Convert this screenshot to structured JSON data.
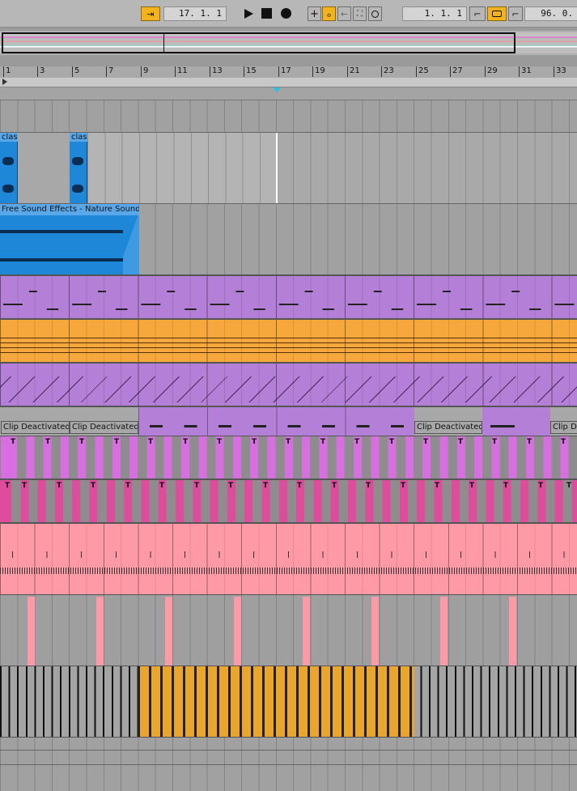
{
  "transport": {
    "follow_icon": "follow-arrow-icon",
    "position": "17.  1.  1",
    "play_icon": "play-icon",
    "stop_icon": "stop-icon",
    "record_icon": "record-icon",
    "loop_start": "1.  1.  1",
    "tempo_like": "96.  0."
  },
  "ruler": {
    "bars": [
      "1",
      "3",
      "5",
      "7",
      "9",
      "11",
      "13",
      "15",
      "17",
      "19",
      "21",
      "23",
      "25",
      "27",
      "29",
      "31",
      "33"
    ]
  },
  "clips": {
    "drum_a_name": "clas",
    "drum_b_name": "clas",
    "audio_name": "Free Sound Effects - Nature Sound",
    "deactivated_label": "Clip Deactivated",
    "deactivated_partial": "Clip De",
    "t_label": "T"
  },
  "colors": {
    "accent": "#f4b21d",
    "blue_clip": "#1f87d8",
    "purple_clip": "#b47fd6",
    "orange_clip": "#f7a83c",
    "magenta_clip": "#d86fe0",
    "pink_clip": "#e04c9c",
    "light_pink_clip": "#fe9aa6"
  }
}
